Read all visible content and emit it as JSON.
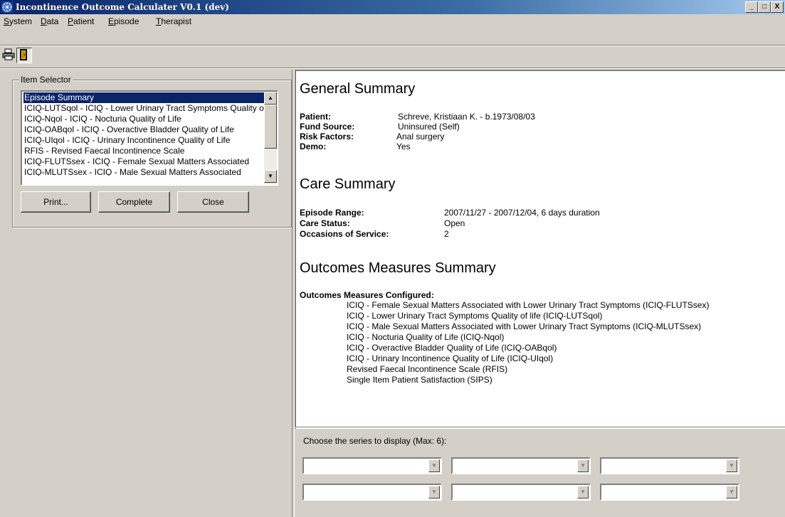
{
  "window": {
    "title": "Incontinence Outcome Calculater V0.1 (dev)",
    "min_label": "_",
    "max_label": "□",
    "close_label": "X"
  },
  "menu": {
    "items": [
      {
        "label": "System",
        "mnemonic": "S",
        "rest": "ystem"
      },
      {
        "label": "Data",
        "mnemonic": "D",
        "rest": "ata"
      },
      {
        "label": "Patient",
        "mnemonic": "P",
        "rest": "atient"
      },
      {
        "label": "Episode",
        "mnemonic": "E",
        "rest": "pisode"
      },
      {
        "label": "Therapist",
        "mnemonic": "T",
        "rest": "herapist"
      }
    ]
  },
  "toolbar": {
    "buttons": [
      {
        "icon": "printer-icon"
      },
      {
        "icon": "door-icon",
        "pressed": true
      }
    ]
  },
  "item_selector": {
    "label": "Item Selector",
    "items": [
      "Episode Summary",
      "ICIQ-LUTSqol - ICIQ - Lower Urinary Tract Symptoms Quality of life",
      "ICIQ-Nqol - ICIQ - Nocturia Quality of Life",
      "ICIQ-OABqol - ICIQ - Overactive Bladder Quality of Life",
      "ICIQ-UIqol - ICIQ - Urinary Incontinence Quality of Life",
      "RFIS - Revised Faecal Incontinence Scale",
      "ICIQ-FLUTSsex - ICIQ - Female Sexual Matters Associated",
      "ICIQ-MLUTSsex - ICIQ - Male Sexual Matters Associated"
    ],
    "selected_index": 0,
    "buttons": {
      "print": "Print...",
      "complete": "Complete",
      "close": "Close"
    }
  },
  "general_summary": {
    "heading": "General Summary",
    "fields": [
      {
        "label": "Patient:",
        "value": "Schreve, Kristiaan K. - b.1973/08/03"
      },
      {
        "label": "Fund Source:",
        "value": "Uninsured (Self)"
      },
      {
        "label": "Risk Factors:",
        "value": "Anal surgery"
      },
      {
        "label": "Demo:",
        "value": "Yes"
      }
    ]
  },
  "care_summary": {
    "heading": "Care Summary",
    "fields": [
      {
        "label": "Episode Range:",
        "value": "2007/11/27 - 2007/12/04, 6 days duration"
      },
      {
        "label": "Care Status:",
        "value": "Open"
      },
      {
        "label": "Occasions of Service:",
        "value": "2"
      }
    ]
  },
  "outcomes_summary": {
    "heading": "Outcomes Measures Summary",
    "configured_label": "Outcomes Measures Configured:",
    "measures": [
      "ICIQ - Female Sexual Matters Associated with Lower Urinary Tract Symptoms (ICIQ-FLUTSsex)",
      "ICIQ - Lower Urinary Tract Symptoms Quality of life (ICIQ-LUTSqol)",
      "ICIQ - Male Sexual Matters Associated with Lower Urinary Tract Symptoms (ICIQ-MLUTSsex)",
      "ICIQ - Nocturia Quality of Life (ICIQ-Nqol)",
      "ICIQ - Overactive Bladder Quality of Life (ICIQ-OABqol)",
      "ICIQ - Urinary Incontinence Quality of Life (ICIQ-UIqol)",
      "Revised Faecal Incontinence Scale (RFIS)",
      "Single Item Patient Satisfaction (SIPS)"
    ]
  },
  "series_selector": {
    "label": "Choose the series to display (Max: 6):",
    "combos": [
      "",
      "",
      "",
      "",
      "",
      ""
    ]
  },
  "colors": {
    "titlebar_start": "#0a246a",
    "titlebar_end": "#a6caf0",
    "selection": "#0a246a",
    "face": "#d4d0c8"
  }
}
